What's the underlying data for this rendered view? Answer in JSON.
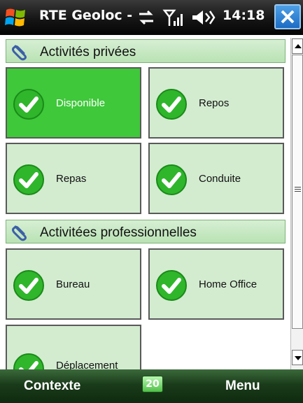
{
  "titlebar": {
    "title": "RTE Geoloc - Co",
    "time": "14:18"
  },
  "sections": [
    {
      "label": "Activités privées",
      "tiles": [
        {
          "label": "Disponible",
          "selected": true
        },
        {
          "label": "Repos",
          "selected": false
        },
        {
          "label": "Repas",
          "selected": false
        },
        {
          "label": "Conduite",
          "selected": false
        }
      ]
    },
    {
      "label": "Activitées professionnelles",
      "tiles": [
        {
          "label": "Bureau",
          "selected": false
        },
        {
          "label": "Home Office",
          "selected": false
        },
        {
          "label": "Déplacement",
          "selected": false
        }
      ]
    }
  ],
  "softkeys": {
    "left": "Contexte",
    "right": "Menu",
    "sip_label": "20"
  },
  "colors": {
    "tile_bg": "#d3ecd0",
    "selected_tile_bg": "#3ec83a",
    "section_header_bg": "#c4e7bf",
    "softkey_bar": "#1a3b1a"
  },
  "icons": {
    "title": "windows-flag-icon",
    "status": [
      "connectivity-icon",
      "signal-icon",
      "volume-icon"
    ],
    "close": "close-icon",
    "section": "paperclip-icon",
    "tile": "green-check-icon"
  }
}
